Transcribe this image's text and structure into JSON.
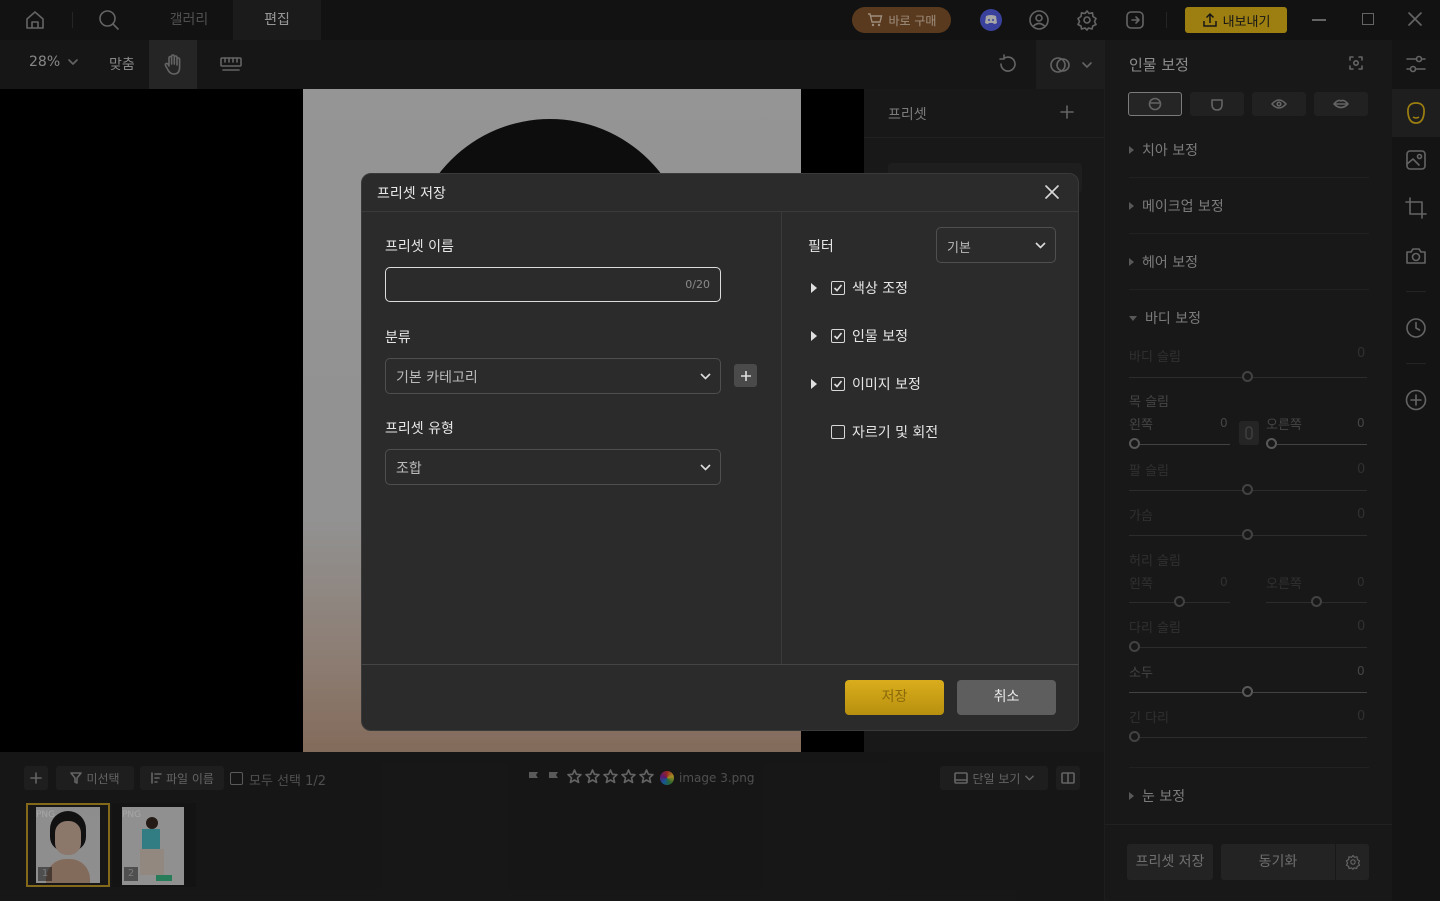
{
  "topbar": {
    "tabs": [
      "갤러리",
      "편집"
    ],
    "buy_label": "바로 구매",
    "export_label": "내보내기"
  },
  "toolbar": {
    "zoom": "28%",
    "fit_label": "맞춤"
  },
  "preset_panel": {
    "title": "프리셋"
  },
  "filmstrip": {
    "unselected_label": "미선택",
    "filename_label": "파일 이름",
    "select_all_label": "모두 선택 1/2",
    "file_name": "image 3.png",
    "single_view_label": "단일 보기",
    "thumbnails": [
      {
        "badge": "PNG",
        "index": "1"
      },
      {
        "badge": "PNG",
        "index": "2"
      }
    ]
  },
  "right_panel": {
    "title": "인물 보정",
    "sections": {
      "teeth": "치아 보정",
      "makeup": "메이크업 보정",
      "hair": "헤어 보정",
      "body": "바디 보정",
      "eye": "눈 보정"
    },
    "sliders": {
      "body_slim": {
        "label": "바디 슬림",
        "value": "0"
      },
      "neck_slim": {
        "label": "목 슬림"
      },
      "left": "왼쪽",
      "right": "오른쪽",
      "neck_left_value": "0",
      "neck_right_value": "0",
      "arm_slim": {
        "label": "팔 슬림",
        "value": "0"
      },
      "chest": {
        "label": "가슴",
        "value": "0"
      },
      "waist_slim": {
        "label": "허리 슬림"
      },
      "waist_left_value": "0",
      "waist_right_value": "0",
      "leg_slim": {
        "label": "다리 슬림",
        "value": "0"
      },
      "head": {
        "label": "소두",
        "value": "0"
      },
      "long_leg": {
        "label": "긴 다리",
        "value": "0"
      }
    },
    "save_preset_label": "프리셋 저장",
    "sync_label": "동기화"
  },
  "dialog": {
    "title": "프리셋 저장",
    "name_label": "프리셋 이름",
    "name_value": "",
    "name_counter": "0/20",
    "category_label": "분류",
    "category_value": "기본 카테고리",
    "type_label": "프리셋 유형",
    "type_value": "조합",
    "filter_label": "필터",
    "filter_value": "기본",
    "options": [
      {
        "label": "색상 조정",
        "checked": true,
        "expandable": true
      },
      {
        "label": "인물 보정",
        "checked": true,
        "expandable": true
      },
      {
        "label": "이미지 보정",
        "checked": true,
        "expandable": true
      },
      {
        "label": "자르기 및 회전",
        "checked": false,
        "expandable": false
      }
    ],
    "save_label": "저장",
    "cancel_label": "취소"
  },
  "colors": {
    "accent_gold": "#f0c419",
    "buy_bg": "#8a5a2e",
    "discord": "#5865f2"
  }
}
